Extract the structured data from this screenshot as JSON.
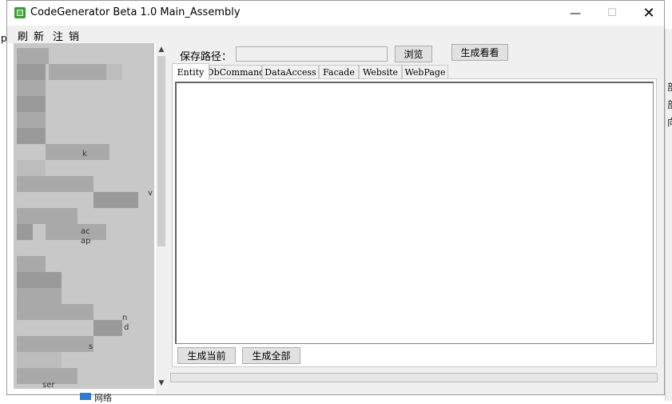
{
  "window": {
    "title": "CodeGenerator Beta 1.0 Main_Assembly",
    "minimize_glyph": "—",
    "maximize_glyph": "☐",
    "close_glyph": "✕"
  },
  "menu": {
    "items": [
      "刷",
      "新",
      "注",
      "销"
    ]
  },
  "background": {
    "left_char": "p",
    "right_chars": [
      "部",
      "部",
      "向"
    ]
  },
  "tree": {
    "scroll_up": "▲",
    "scroll_down": "▼",
    "visible_fragments": [
      "k",
      "v",
      "ac",
      "ap",
      "n",
      "d",
      "s",
      "ser"
    ],
    "network_label": "网络"
  },
  "save_path": {
    "label": "保存路径：",
    "value": "",
    "browse_button": "浏览",
    "preview_button": "生成看看"
  },
  "tabs": [
    {
      "label": "Entity",
      "active": true
    },
    {
      "label": "DbCommand",
      "active": false
    },
    {
      "label": "DataAccess",
      "active": false
    },
    {
      "label": "Facade",
      "active": false
    },
    {
      "label": "Website",
      "active": false
    },
    {
      "label": "WebPage",
      "active": false
    }
  ],
  "editor": {
    "content": ""
  },
  "actions": {
    "generate_current": "生成当前",
    "generate_all": "生成全部"
  },
  "progress": {
    "value": 0
  }
}
